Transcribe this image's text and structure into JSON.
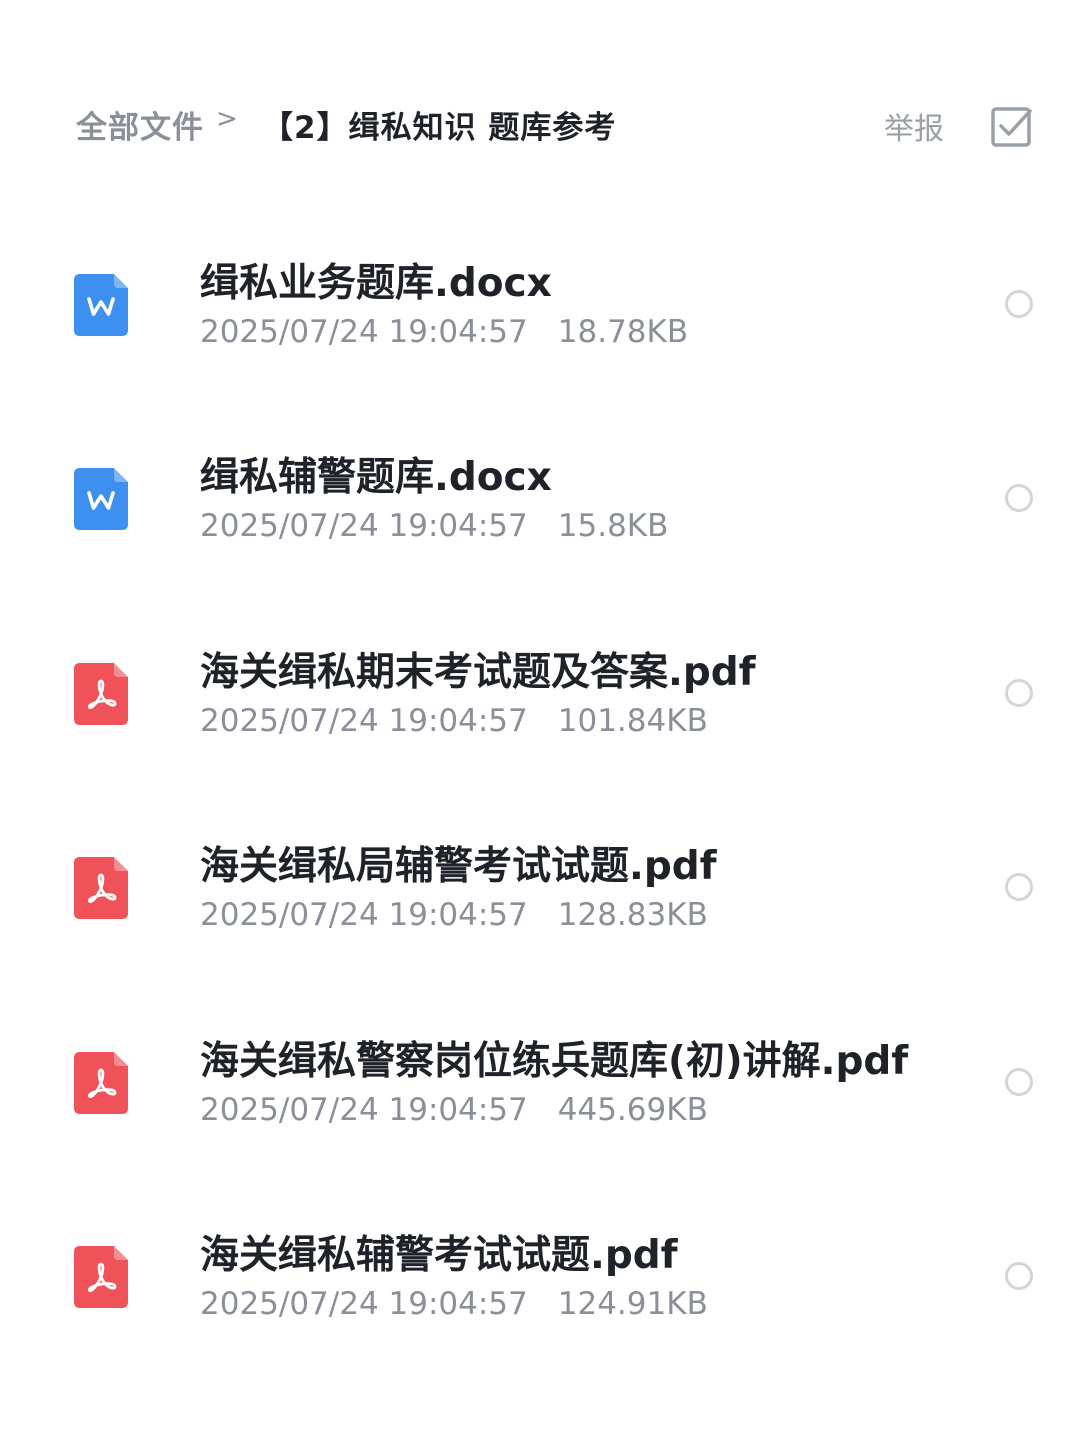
{
  "header": {
    "breadcrumb_root": "全部文件",
    "breadcrumb_separator": ">",
    "current_folder": "【2】缉私知识 题库参考",
    "report_label": "举报",
    "select_icon": "checkbox-icon"
  },
  "colors": {
    "word_icon": "#3d8ff0",
    "pdf_icon": "#f0525a",
    "title_text": "#1f2329",
    "secondary_text": "#8a8f99"
  },
  "files": [
    {
      "name": "缉私业务题库.docx",
      "date": "2025/07/24 19:04:57",
      "size": "18.78KB",
      "type": "word",
      "icon": "word-file-icon"
    },
    {
      "name": "缉私辅警题库.docx",
      "date": "2025/07/24 19:04:57",
      "size": "15.8KB",
      "type": "word",
      "icon": "word-file-icon"
    },
    {
      "name": "海关缉私期末考试题及答案.pdf",
      "date": "2025/07/24 19:04:57",
      "size": "101.84KB",
      "type": "pdf",
      "icon": "pdf-file-icon"
    },
    {
      "name": "海关缉私局辅警考试试题.pdf",
      "date": "2025/07/24 19:04:57",
      "size": "128.83KB",
      "type": "pdf",
      "icon": "pdf-file-icon"
    },
    {
      "name": "海关缉私警察岗位练兵题库(初)讲解.pdf",
      "date": "2025/07/24 19:04:57",
      "size": "445.69KB",
      "type": "pdf",
      "icon": "pdf-file-icon"
    },
    {
      "name": "海关缉私辅警考试试题.pdf",
      "date": "2025/07/24 19:04:57",
      "size": "124.91KB",
      "type": "pdf",
      "icon": "pdf-file-icon"
    }
  ]
}
